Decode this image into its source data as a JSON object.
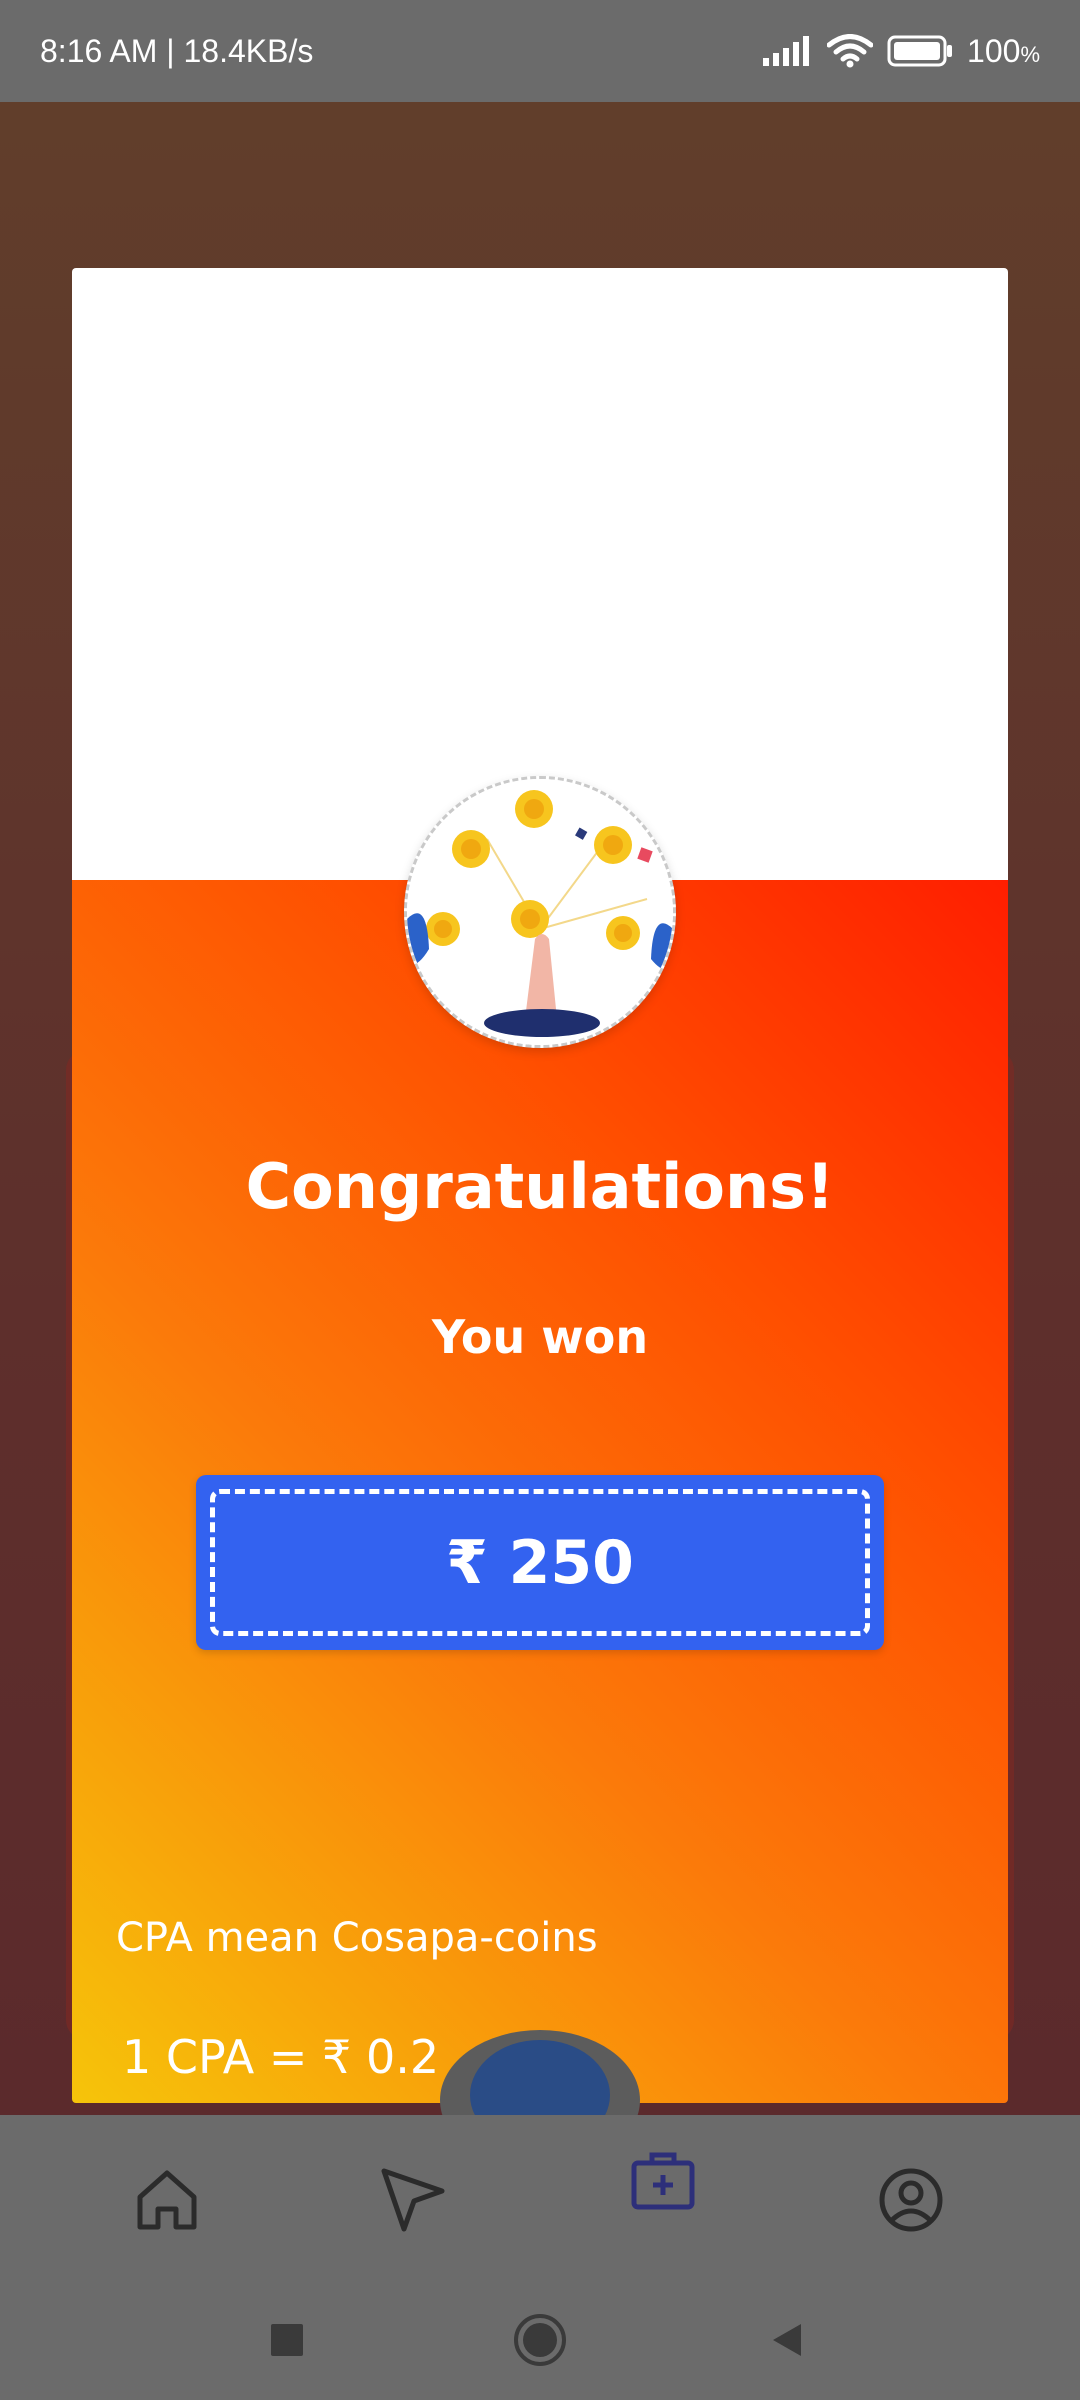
{
  "status_bar": {
    "time_speed": "8:16 AM | 18.4KB/s",
    "battery": "100",
    "battery_unit": "%"
  },
  "reward_dialog": {
    "title": "Congratulations!",
    "subtitle": "You won",
    "amount": "₹ 250",
    "note_line1": "CPA mean Cosapa-coins",
    "note_line2": "1 CPA = ₹ 0.2"
  },
  "bottom_nav": {
    "items": [
      {
        "icon": "home-icon"
      },
      {
        "icon": "send-icon"
      },
      {
        "icon": "medical-bag-icon",
        "active": true
      },
      {
        "icon": "profile-icon"
      }
    ],
    "active_color": "#2d2f7a",
    "inactive_color": "#2b2b2b"
  },
  "colors": {
    "gradient_start": "#f6c40a",
    "gradient_end": "#ff1e00",
    "prize_bg": "#3362f0"
  }
}
